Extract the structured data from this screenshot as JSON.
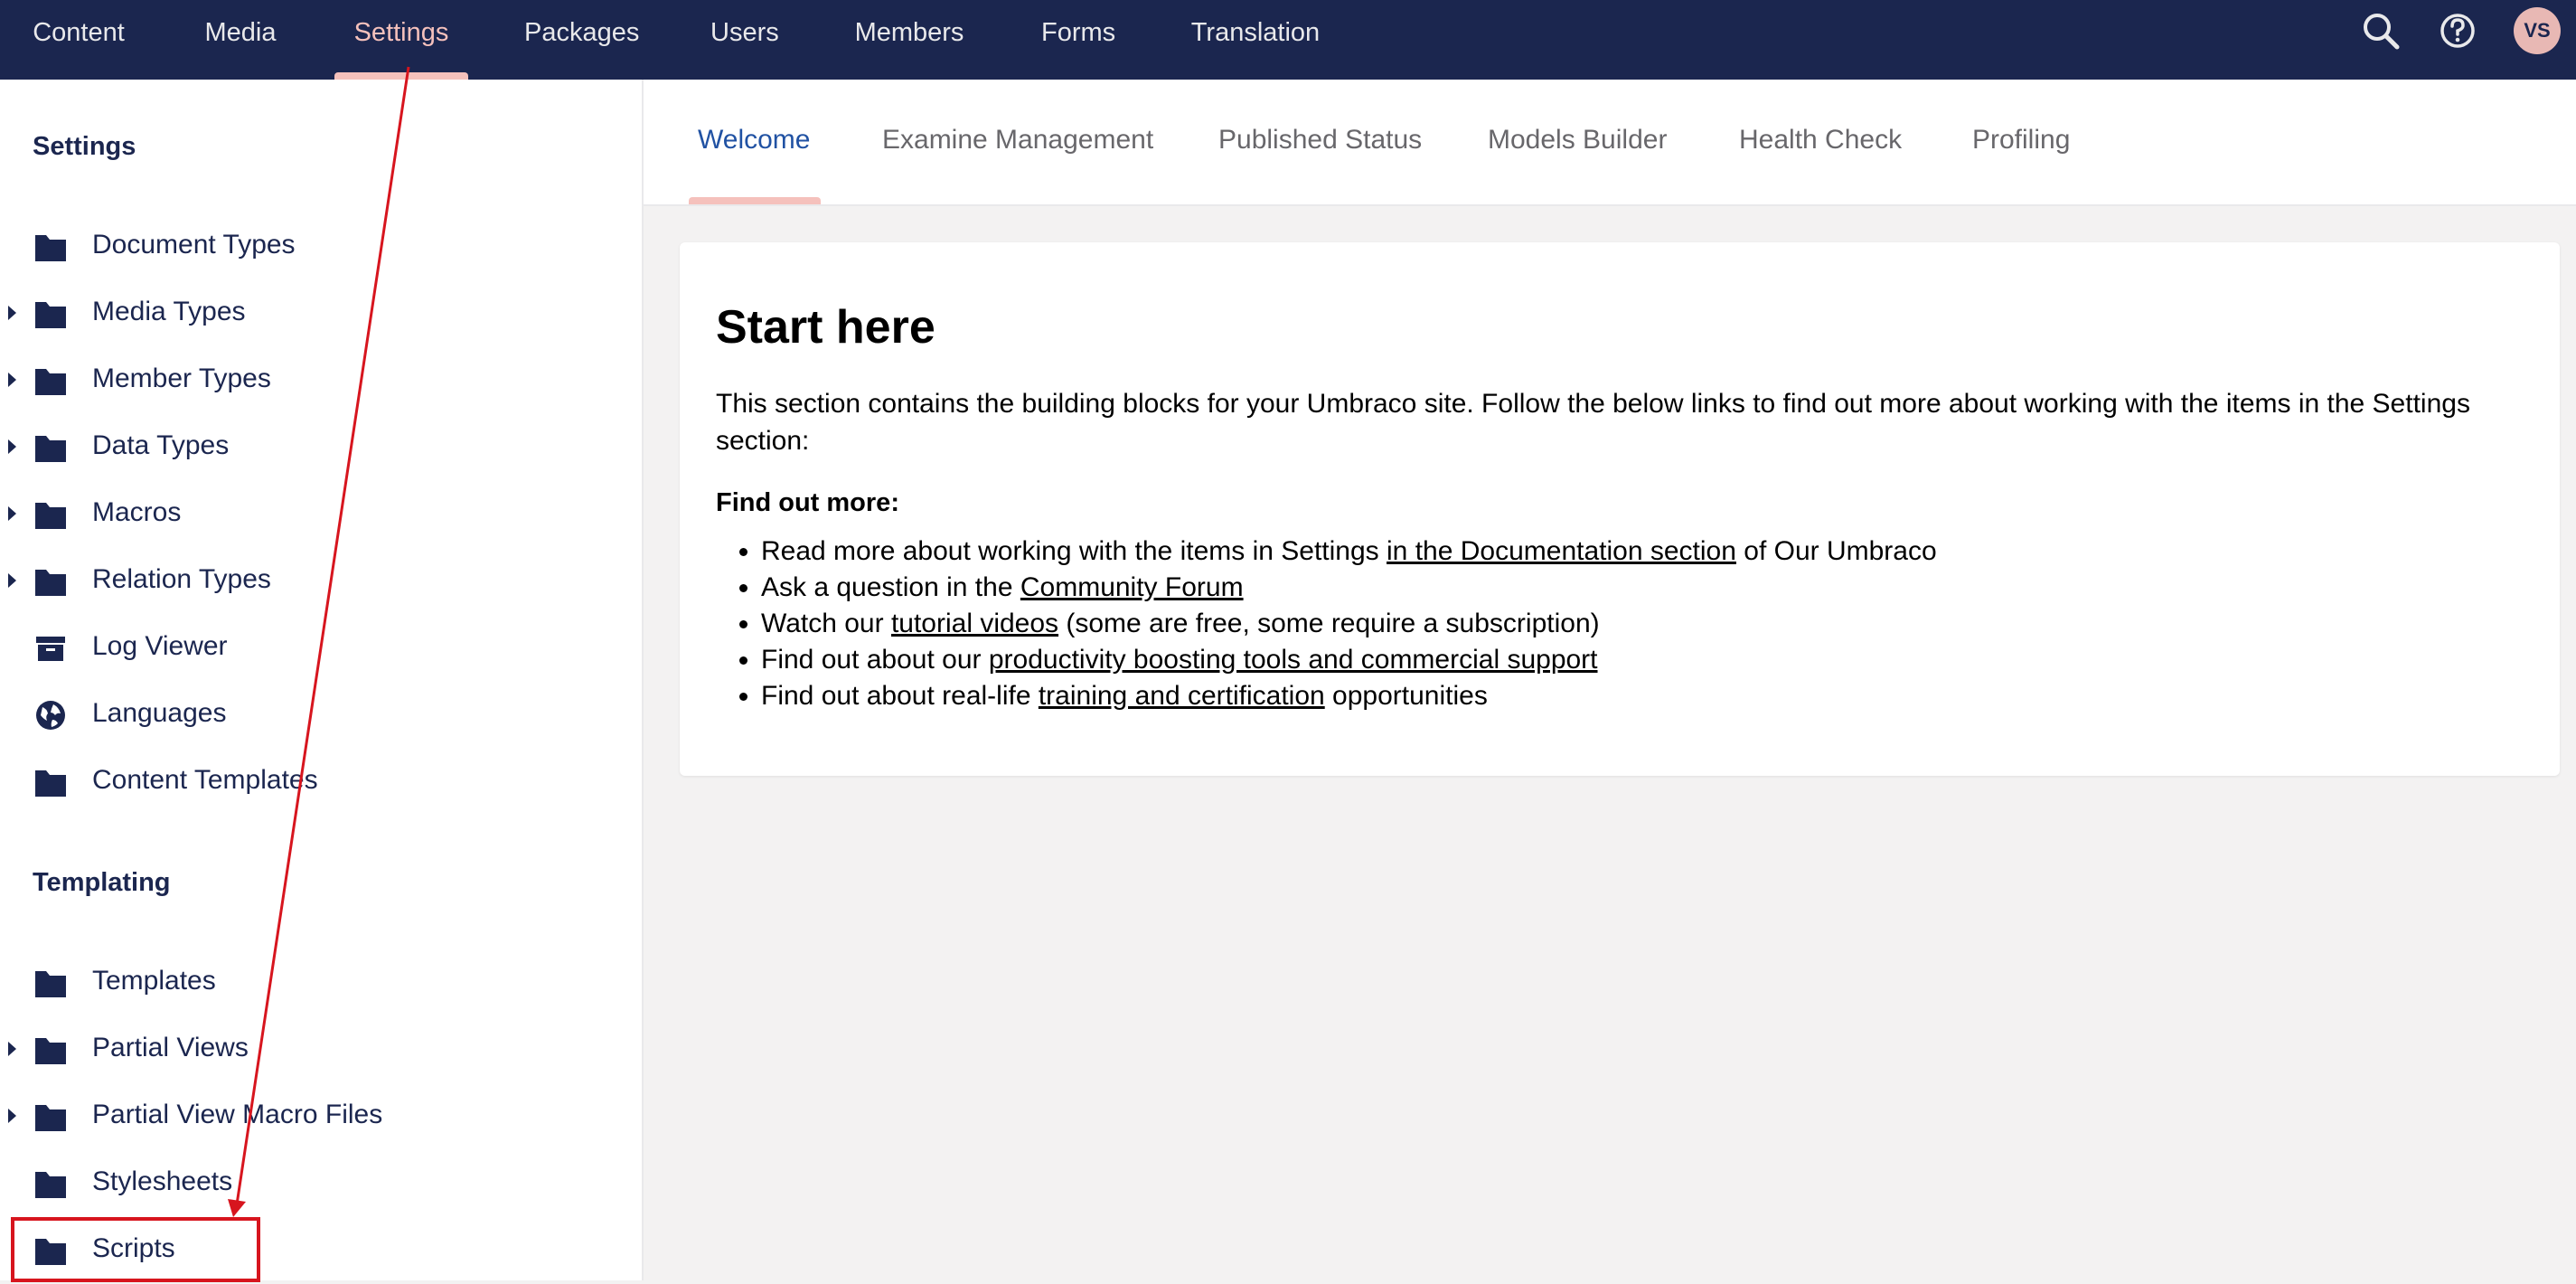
{
  "nav": {
    "items": [
      "Content",
      "Media",
      "Settings",
      "Packages",
      "Users",
      "Members",
      "Forms",
      "Translation"
    ],
    "active": "Settings",
    "avatar_initials": "VS",
    "search_icon": "search-icon",
    "help_icon": "help-icon"
  },
  "sidebar": {
    "settings_title": "Settings",
    "settings_items": [
      {
        "label": "Document Types",
        "icon": "folder-icon"
      },
      {
        "label": "Media Types",
        "icon": "folder-icon"
      },
      {
        "label": "Member Types",
        "icon": "folder-icon"
      },
      {
        "label": "Data Types",
        "icon": "folder-icon"
      },
      {
        "label": "Macros",
        "icon": "folder-icon"
      },
      {
        "label": "Relation Types",
        "icon": "folder-icon"
      },
      {
        "label": "Log Viewer",
        "icon": "archive-icon"
      },
      {
        "label": "Languages",
        "icon": "globe-icon"
      },
      {
        "label": "Content Templates",
        "icon": "folder-icon"
      }
    ],
    "templating_title": "Templating",
    "templating_items": [
      {
        "label": "Templates",
        "icon": "folder-icon"
      },
      {
        "label": "Partial Views",
        "icon": "folder-icon"
      },
      {
        "label": "Partial View Macro Files",
        "icon": "folder-icon"
      },
      {
        "label": "Stylesheets",
        "icon": "folder-icon"
      },
      {
        "label": "Scripts",
        "icon": "folder-icon"
      }
    ]
  },
  "tabs": [
    "Welcome",
    "Examine Management",
    "Published Status",
    "Models Builder",
    "Health Check",
    "Profiling"
  ],
  "active_tab": "Welcome",
  "card": {
    "title": "Start here",
    "intro": "This section contains the building blocks for your Umbraco site. Follow the below links to find out more about working with the items in the Settings section:",
    "find_out_more": "Find out more:",
    "bullets": [
      {
        "before": "Read more about working with the items in Settings ",
        "link": "in the Documentation section",
        "after": " of Our Umbraco"
      },
      {
        "before": "Ask a question in the ",
        "link": "Community Forum",
        "after": ""
      },
      {
        "before": "Watch our ",
        "link": "tutorial videos",
        "after": " (some are free, some require a subscription)"
      },
      {
        "before": "Find out about our ",
        "link": "productivity boosting tools and commercial support",
        "after": ""
      },
      {
        "before": "Find out about real-life ",
        "link": "training and certification",
        "after": " opportunities"
      }
    ]
  },
  "colors": {
    "topbar": "#1b264f",
    "accent": "#f5c1bc",
    "active_tab": "#2152a3",
    "annotation": "#d7151e"
  }
}
